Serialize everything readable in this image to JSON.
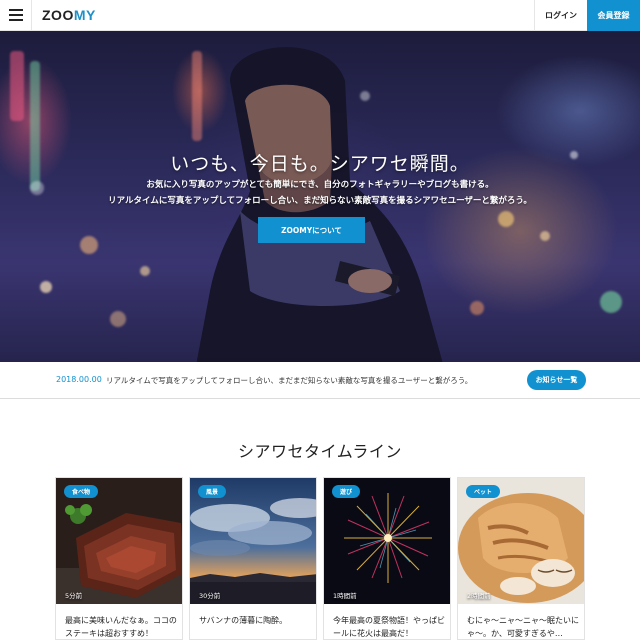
{
  "header": {
    "logo_main": "ZOO",
    "logo_accent": "MY",
    "login_label": "ログイン",
    "signup_label": "会員登録"
  },
  "hero": {
    "title": "いつも、今日も。シアワセ瞬間。",
    "subtitle_line1": "お気に入り写真のアップがとても簡単にでき、自分のフォトギャラリーやブログも書ける。",
    "subtitle_line2": "リアルタイムに写真をアップしてフォローし合い、まだ知らない素敵写真を撮るシアワセユーザーと繋がろう。",
    "button_label": "ZOOMYについて"
  },
  "news": {
    "date": "2018.00.00",
    "text": "リアルタイムで写真をアップしてフォローし合い、まだまだ知らない素敵な写真を撮るユーザーと繋がろう。",
    "button_label": "お知らせ一覧"
  },
  "timeline": {
    "title": "シアワセタイムライン",
    "cards": [
      {
        "tag": "食べ物",
        "time": "5分前",
        "caption": "最高に美味いんだなぁ。ココのステーキは超おすすめ！",
        "photo_icon": "steak-photo"
      },
      {
        "tag": "風景",
        "time": "30分前",
        "caption": "サバンナの薄暮に陶酔。",
        "photo_icon": "sunset-photo"
      },
      {
        "tag": "遊び",
        "time": "1時間前",
        "caption": "今年最高の夏祭物語！やっぱビールに花火は最高だ！",
        "photo_icon": "fireworks-photo"
      },
      {
        "tag": "ペット",
        "time": "2時間前",
        "caption": "むにゃ〜ニャ〜ニャ〜眠たいにゃ〜。か、可愛すぎるや…",
        "photo_icon": "cat-photo"
      }
    ]
  },
  "colors": {
    "accent": "#1191cf",
    "text": "#222222",
    "border": "#e2e2e2"
  }
}
